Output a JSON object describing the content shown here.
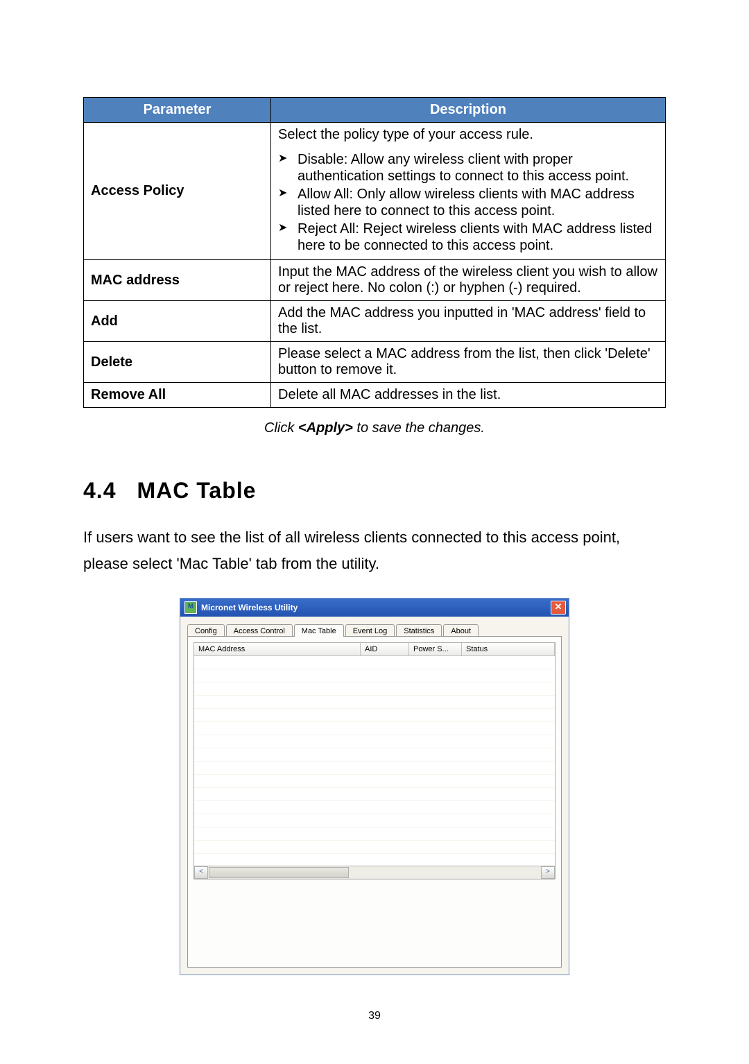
{
  "table": {
    "header_param": "Parameter",
    "header_desc": "Description",
    "rows": [
      {
        "label": "Access Policy",
        "intro": "Select the policy type of your access rule.",
        "bullets": [
          "Disable: Allow any wireless client with proper authentication settings to connect to this access point.",
          "Allow All: Only allow wireless clients with MAC address listed here to connect to this access point.",
          "Reject All: Reject wireless clients with MAC address listed here to be connected to this access point."
        ]
      },
      {
        "label": "MAC address",
        "desc": "Input the MAC address of the wireless client you wish to allow or reject here. No colon (:) or hyphen (-) required."
      },
      {
        "label": "Add",
        "desc": "Add the MAC address you inputted in 'MAC address' field to the list."
      },
      {
        "label": "Delete",
        "desc": "Please select a MAC address from the list, then click 'Delete' button to remove it."
      },
      {
        "label": "Remove All",
        "desc": "Delete all MAC addresses in the list."
      }
    ]
  },
  "caption": {
    "pre": "Click ",
    "apply": "<Apply>",
    "post": " to save the changes."
  },
  "section": {
    "num": "4.4",
    "title": "MAC Table"
  },
  "body_text": "If users want to see the list of all wireless clients connected to this access point, please select 'Mac Table' tab from the utility.",
  "window": {
    "title": "Micronet Wireless Utility",
    "icon_glyph": "M",
    "tabs": [
      "Config",
      "Access Control",
      "Mac Table",
      "Event Log",
      "Statistics",
      "About"
    ],
    "active_tab_index": 2,
    "columns": [
      "MAC Address",
      "AID",
      "Power S...",
      "Status"
    ],
    "scroll_left": "<",
    "scroll_right": ">"
  },
  "page_number": "39"
}
